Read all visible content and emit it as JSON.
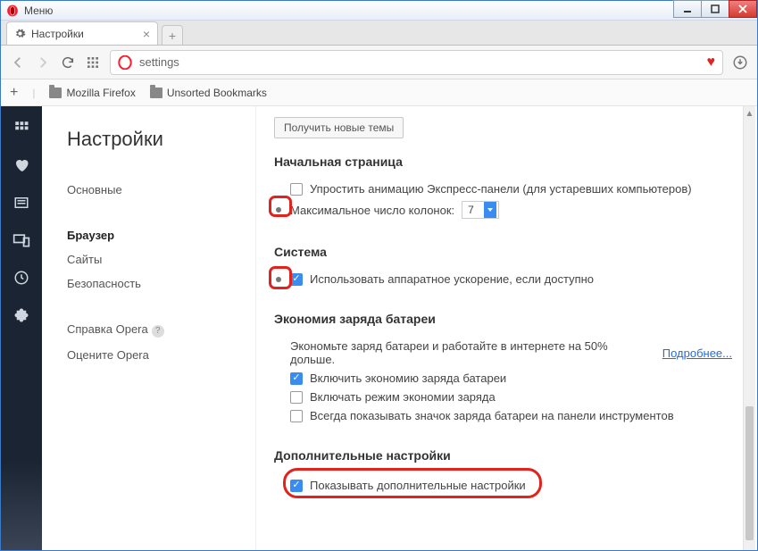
{
  "window": {
    "menu_label": "Меню"
  },
  "tab": {
    "title": "Настройки"
  },
  "address": {
    "value": "settings"
  },
  "bookmarks": {
    "item1": "Mozilla Firefox",
    "item2": "Unsorted Bookmarks"
  },
  "settings": {
    "title": "Настройки",
    "menu": {
      "basic": "Основные",
      "browser": "Браузер",
      "sites": "Сайты",
      "security": "Безопасность",
      "help": "Справка Opera",
      "rate": "Оцените Opera"
    }
  },
  "pane": {
    "themes_button": "Получить новые темы",
    "start_page": {
      "heading": "Начальная страница",
      "simplify": "Упростить анимацию Экспресс-панели (для устаревших компьютеров)",
      "max_cols_label": "Максимальное число колонок:",
      "max_cols_value": "7"
    },
    "system": {
      "heading": "Система",
      "hw_accel": "Использовать аппаратное ускорение, если доступно"
    },
    "battery": {
      "heading": "Экономия заряда батареи",
      "info": "Экономьте заряд батареи и работайте в интернете на 50% дольше.",
      "more": "Подробнее...",
      "opt1": "Включить экономию заряда батареи",
      "opt2": "Включать режим экономии заряда",
      "opt3": "Всегда показывать значок заряда батареи на панели инструментов"
    },
    "advanced": {
      "heading": "Дополнительные настройки",
      "show": "Показывать дополнительные настройки"
    }
  }
}
